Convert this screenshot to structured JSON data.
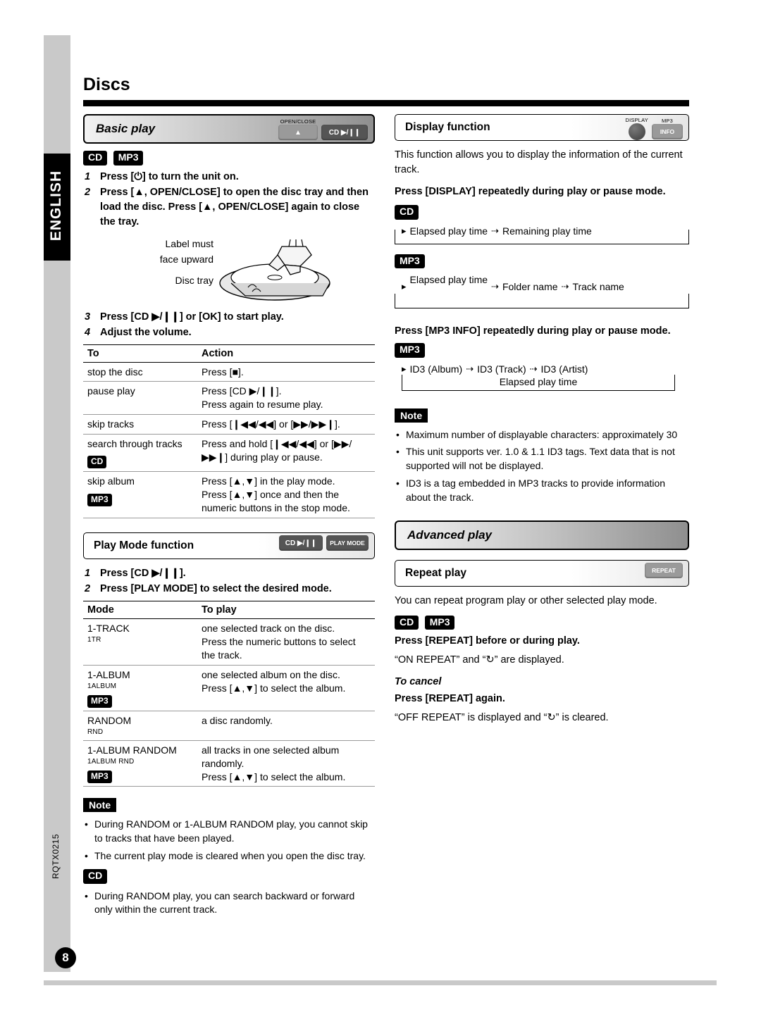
{
  "page": {
    "title": "Discs",
    "language_tab": "ENGLISH",
    "page_number": "8",
    "doc_code": "RQTX0215"
  },
  "left_column": {
    "basic_play": {
      "heading": "Basic play",
      "icons": [
        {
          "name": "open-close-button",
          "label": "OPEN/CLOSE",
          "glyph": "▲"
        },
        {
          "name": "cd-play-pause-button",
          "label": "",
          "glyph": "CD ▶/❙❙"
        }
      ],
      "tags": [
        "CD",
        "MP3"
      ],
      "steps": [
        {
          "n": "1",
          "text": "Press [⏻] to turn the unit on."
        },
        {
          "n": "2",
          "text": "Press [▲, OPEN/CLOSE] to open the disc tray and then load the disc. Press [▲, OPEN/CLOSE] again to close the tray."
        },
        {
          "n": "3",
          "text": "Press [CD ▶/❙❙] or [OK] to start play."
        },
        {
          "n": "4",
          "text": "Adjust the volume."
        }
      ],
      "illustration_labels": [
        "Label must",
        "face upward",
        "Disc tray"
      ],
      "table": {
        "headers": [
          "To",
          "Action"
        ],
        "rows": [
          {
            "to": "stop the disc",
            "action": "Press [■].",
            "tag": ""
          },
          {
            "to": "pause play",
            "action": "Press [CD ▶/❙❙].\nPress again to resume play.",
            "tag": ""
          },
          {
            "to": "skip tracks",
            "action": "Press [❙◀◀/◀◀] or [▶▶/▶▶❙].",
            "tag": ""
          },
          {
            "to": "search through tracks",
            "action": "Press and hold [❙◀◀/◀◀] or [▶▶/▶▶❙] during play or pause.",
            "tag": "CD"
          },
          {
            "to": "skip album",
            "action": "Press [▲,▼] in the play mode.\nPress [▲,▼] once and then the numeric buttons in the stop mode.",
            "tag": "MP3"
          }
        ]
      }
    },
    "play_mode": {
      "heading": "Play Mode function",
      "icons": [
        {
          "name": "cd-play-pause-button",
          "glyph": "CD ▶/❙❙"
        },
        {
          "name": "play-mode-button",
          "glyph": "PLAY MODE"
        }
      ],
      "steps": [
        {
          "n": "1",
          "text": "Press [CD ▶/❙❙]."
        },
        {
          "n": "2",
          "text": "Press [PLAY MODE] to select the desired mode."
        }
      ],
      "table": {
        "headers": [
          "Mode",
          "To play"
        ],
        "rows": [
          {
            "mode": "1-TRACK",
            "mode_sub": "1TR",
            "mode_tag": "",
            "play": "one selected track on the disc.\nPress the numeric buttons to select the track."
          },
          {
            "mode": "1-ALBUM",
            "mode_sub": "1ALBUM",
            "mode_tag": "MP3",
            "play": "one selected album on the disc.\nPress [▲,▼] to select the album."
          },
          {
            "mode": "RANDOM",
            "mode_sub": "RND",
            "mode_tag": "",
            "play": "a disc randomly."
          },
          {
            "mode": "1-ALBUM RANDOM",
            "mode_sub": "1ALBUM RND",
            "mode_tag": "MP3",
            "play": "all tracks in one selected album randomly.\nPress [▲,▼] to select the album."
          }
        ]
      }
    },
    "note": {
      "label": "Note",
      "bullets": [
        "During RANDOM or 1-ALBUM RANDOM play, you cannot skip to tracks that have been played.",
        "The current play mode is cleared when you open the disc tray."
      ],
      "cd_tag": "CD",
      "cd_bullets": [
        "During RANDOM play, you can search backward or forward only within the current track."
      ]
    }
  },
  "right_column": {
    "display_function": {
      "heading": "Display function",
      "icons": [
        {
          "name": "display-button",
          "label": "DISPLAY",
          "glyph": "●"
        },
        {
          "name": "mp3-info-button",
          "label": "MP3",
          "glyph": "INFO"
        }
      ],
      "intro": "This function allows you to display the information of the current track.",
      "instruction": "Press [DISPLAY] repeatedly during play or pause mode.",
      "cd_tag": "CD",
      "cd_flow": [
        "Elapsed play time",
        "Remaining play time"
      ],
      "mp3_tag": "MP3",
      "mp3_flow": [
        "Elapsed play time",
        "Folder name",
        "Track name"
      ],
      "instruction2": "Press [MP3 INFO] repeatedly during play or pause mode.",
      "mp3_tag2": "MP3",
      "mp3_flow2": [
        "ID3 (Album)",
        "ID3 (Track)",
        "ID3 (Artist)",
        "Elapsed play time"
      ],
      "note": {
        "label": "Note",
        "bullets": [
          "Maximum number of displayable characters: approximately 30",
          "This unit supports ver. 1.0 & 1.1 ID3 tags. Text data that is not supported will not be displayed.",
          "ID3 is a tag embedded in MP3 tracks to provide information about the track."
        ]
      }
    },
    "advanced_play": {
      "heading": "Advanced play",
      "repeat_play": {
        "heading": "Repeat play",
        "icon": {
          "name": "repeat-button",
          "glyph": "REPEAT"
        },
        "intro": "You can repeat program play or other selected play mode.",
        "tags": [
          "CD",
          "MP3"
        ],
        "instruction": "Press [REPEAT] before or during play.",
        "result": "“ON REPEAT” and “↻” are displayed.",
        "cancel_label": "To cancel",
        "cancel_instruction": "Press [REPEAT] again.",
        "cancel_result": "“OFF REPEAT” is displayed and “↻” is cleared."
      }
    }
  }
}
